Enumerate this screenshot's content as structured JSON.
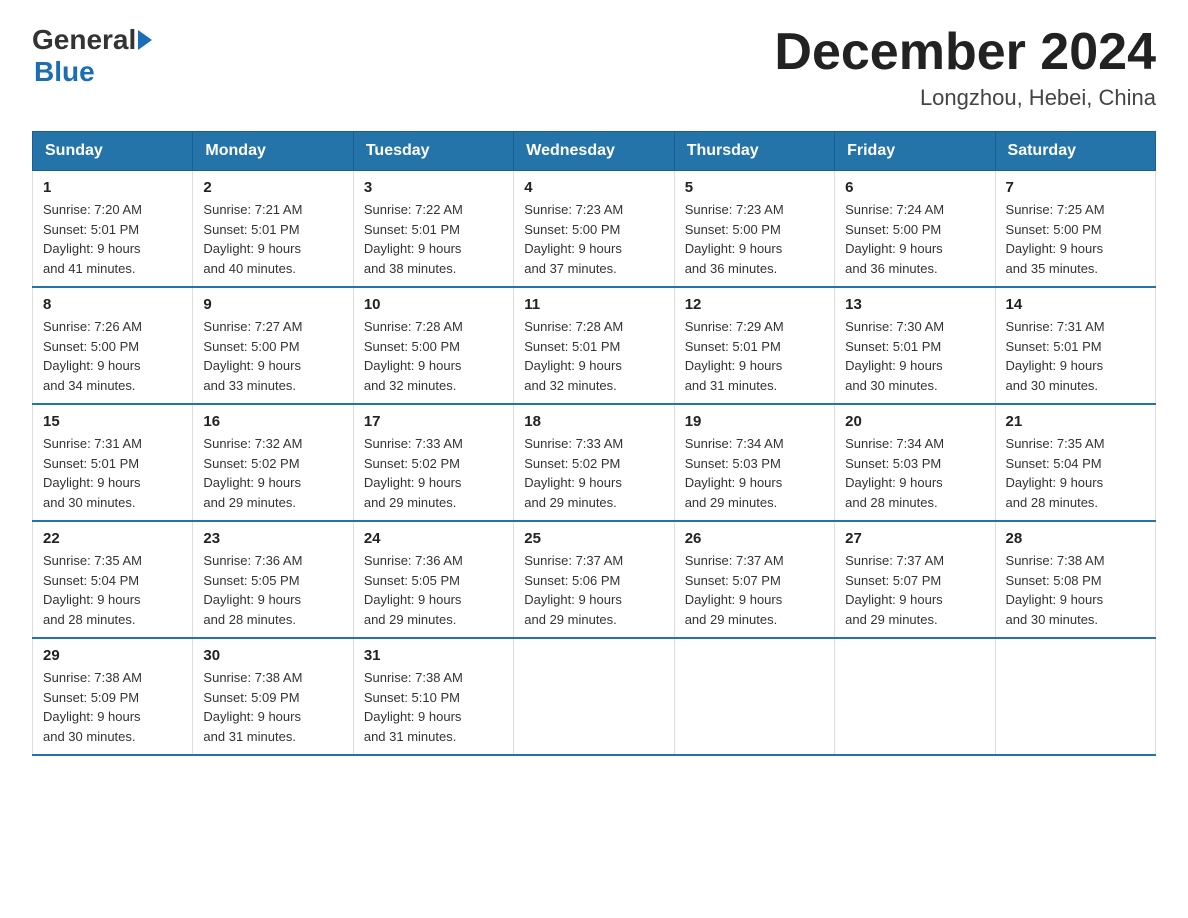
{
  "header": {
    "logo_general": "General",
    "logo_blue": "Blue",
    "title": "December 2024",
    "subtitle": "Longzhou, Hebei, China"
  },
  "days_of_week": [
    "Sunday",
    "Monday",
    "Tuesday",
    "Wednesday",
    "Thursday",
    "Friday",
    "Saturday"
  ],
  "weeks": [
    [
      {
        "day": "1",
        "sunrise": "7:20 AM",
        "sunset": "5:01 PM",
        "daylight": "9 hours and 41 minutes."
      },
      {
        "day": "2",
        "sunrise": "7:21 AM",
        "sunset": "5:01 PM",
        "daylight": "9 hours and 40 minutes."
      },
      {
        "day": "3",
        "sunrise": "7:22 AM",
        "sunset": "5:01 PM",
        "daylight": "9 hours and 38 minutes."
      },
      {
        "day": "4",
        "sunrise": "7:23 AM",
        "sunset": "5:00 PM",
        "daylight": "9 hours and 37 minutes."
      },
      {
        "day": "5",
        "sunrise": "7:23 AM",
        "sunset": "5:00 PM",
        "daylight": "9 hours and 36 minutes."
      },
      {
        "day": "6",
        "sunrise": "7:24 AM",
        "sunset": "5:00 PM",
        "daylight": "9 hours and 36 minutes."
      },
      {
        "day": "7",
        "sunrise": "7:25 AM",
        "sunset": "5:00 PM",
        "daylight": "9 hours and 35 minutes."
      }
    ],
    [
      {
        "day": "8",
        "sunrise": "7:26 AM",
        "sunset": "5:00 PM",
        "daylight": "9 hours and 34 minutes."
      },
      {
        "day": "9",
        "sunrise": "7:27 AM",
        "sunset": "5:00 PM",
        "daylight": "9 hours and 33 minutes."
      },
      {
        "day": "10",
        "sunrise": "7:28 AM",
        "sunset": "5:00 PM",
        "daylight": "9 hours and 32 minutes."
      },
      {
        "day": "11",
        "sunrise": "7:28 AM",
        "sunset": "5:01 PM",
        "daylight": "9 hours and 32 minutes."
      },
      {
        "day": "12",
        "sunrise": "7:29 AM",
        "sunset": "5:01 PM",
        "daylight": "9 hours and 31 minutes."
      },
      {
        "day": "13",
        "sunrise": "7:30 AM",
        "sunset": "5:01 PM",
        "daylight": "9 hours and 30 minutes."
      },
      {
        "day": "14",
        "sunrise": "7:31 AM",
        "sunset": "5:01 PM",
        "daylight": "9 hours and 30 minutes."
      }
    ],
    [
      {
        "day": "15",
        "sunrise": "7:31 AM",
        "sunset": "5:01 PM",
        "daylight": "9 hours and 30 minutes."
      },
      {
        "day": "16",
        "sunrise": "7:32 AM",
        "sunset": "5:02 PM",
        "daylight": "9 hours and 29 minutes."
      },
      {
        "day": "17",
        "sunrise": "7:33 AM",
        "sunset": "5:02 PM",
        "daylight": "9 hours and 29 minutes."
      },
      {
        "day": "18",
        "sunrise": "7:33 AM",
        "sunset": "5:02 PM",
        "daylight": "9 hours and 29 minutes."
      },
      {
        "day": "19",
        "sunrise": "7:34 AM",
        "sunset": "5:03 PM",
        "daylight": "9 hours and 29 minutes."
      },
      {
        "day": "20",
        "sunrise": "7:34 AM",
        "sunset": "5:03 PM",
        "daylight": "9 hours and 28 minutes."
      },
      {
        "day": "21",
        "sunrise": "7:35 AM",
        "sunset": "5:04 PM",
        "daylight": "9 hours and 28 minutes."
      }
    ],
    [
      {
        "day": "22",
        "sunrise": "7:35 AM",
        "sunset": "5:04 PM",
        "daylight": "9 hours and 28 minutes."
      },
      {
        "day": "23",
        "sunrise": "7:36 AM",
        "sunset": "5:05 PM",
        "daylight": "9 hours and 28 minutes."
      },
      {
        "day": "24",
        "sunrise": "7:36 AM",
        "sunset": "5:05 PM",
        "daylight": "9 hours and 29 minutes."
      },
      {
        "day": "25",
        "sunrise": "7:37 AM",
        "sunset": "5:06 PM",
        "daylight": "9 hours and 29 minutes."
      },
      {
        "day": "26",
        "sunrise": "7:37 AM",
        "sunset": "5:07 PM",
        "daylight": "9 hours and 29 minutes."
      },
      {
        "day": "27",
        "sunrise": "7:37 AM",
        "sunset": "5:07 PM",
        "daylight": "9 hours and 29 minutes."
      },
      {
        "day": "28",
        "sunrise": "7:38 AM",
        "sunset": "5:08 PM",
        "daylight": "9 hours and 30 minutes."
      }
    ],
    [
      {
        "day": "29",
        "sunrise": "7:38 AM",
        "sunset": "5:09 PM",
        "daylight": "9 hours and 30 minutes."
      },
      {
        "day": "30",
        "sunrise": "7:38 AM",
        "sunset": "5:09 PM",
        "daylight": "9 hours and 31 minutes."
      },
      {
        "day": "31",
        "sunrise": "7:38 AM",
        "sunset": "5:10 PM",
        "daylight": "9 hours and 31 minutes."
      },
      null,
      null,
      null,
      null
    ]
  ],
  "labels": {
    "sunrise": "Sunrise:",
    "sunset": "Sunset:",
    "daylight": "Daylight:"
  }
}
